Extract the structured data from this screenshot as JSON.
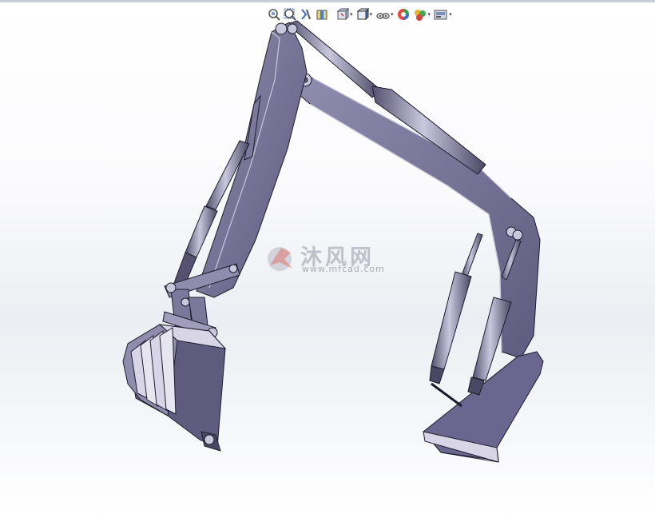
{
  "app": "SolidWorks 3D viewport",
  "heads_up_toolbar": {
    "items": [
      {
        "name": "zoom-to-fit-icon",
        "dropdown": false
      },
      {
        "name": "zoom-to-area-icon",
        "dropdown": false
      },
      {
        "name": "previous-view-icon",
        "dropdown": false
      },
      {
        "name": "section-view-icon",
        "dropdown": false
      },
      {
        "name": "view-orientation-icon",
        "dropdown": true
      },
      {
        "name": "display-style-icon",
        "dropdown": true
      },
      {
        "name": "hide-show-items-icon",
        "dropdown": true
      },
      {
        "name": "edit-appearance-icon",
        "dropdown": false
      },
      {
        "name": "apply-scene-icon",
        "dropdown": true
      },
      {
        "name": "view-settings-icon",
        "dropdown": true
      }
    ],
    "caret": "▾"
  },
  "watermark": {
    "text": "沐风网",
    "url": "www.mfcad.com"
  },
  "colors": {
    "part_fill": "#5f5b7f",
    "part_light": "#8f8cae",
    "part_highlight": "#c9c7dd",
    "part_edge": "#1e1c2c"
  },
  "model": {
    "name": "excavator boom, stick and bucket assembly"
  }
}
